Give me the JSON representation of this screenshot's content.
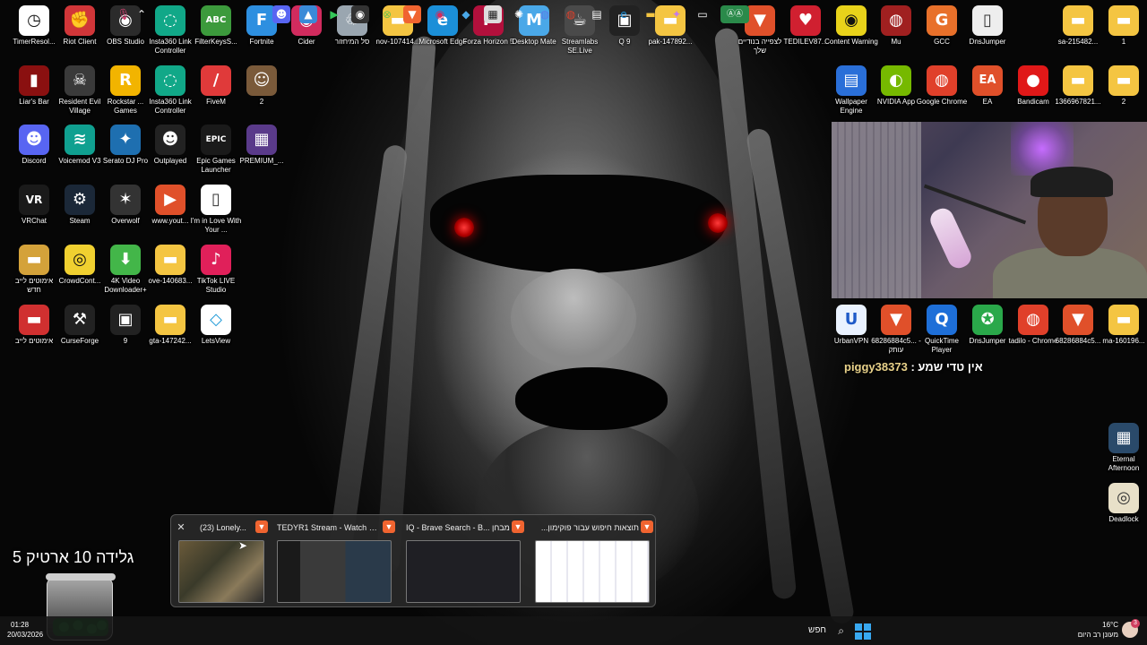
{
  "desktop_icons": [
    {
      "label": "TimerResol...",
      "glyph": "◷",
      "color": "#ffffff",
      "text_color": "#111111"
    },
    {
      "label": "Riot Client",
      "glyph": "✊",
      "color": "#d13639"
    },
    {
      "label": "OBS Studio",
      "glyph": "◉",
      "color": "#2b2b2b"
    },
    {
      "label": "Insta360 Link Controller",
      "glyph": "◌",
      "color": "#11a888"
    },
    {
      "label": "FilterKeysS...",
      "glyph": "ABC",
      "color": "#3c9a3c"
    },
    {
      "label": "Fortnite",
      "glyph": "F",
      "color": "#2d8fe0"
    },
    {
      "label": "Cider",
      "glyph": "◉",
      "color": "#d12b5e"
    },
    {
      "label": "סל המיחזור",
      "glyph": "♲",
      "color": "#9aa6b0"
    },
    {
      "label": "nov-107414...",
      "glyph": "▬",
      "color": "#f4c542"
    },
    {
      "label": "Microsoft Edge",
      "glyph": "e",
      "color": "#1b8fd8"
    },
    {
      "label": "Forza Horizon 5",
      "glyph": "F",
      "color": "#b2103c"
    },
    {
      "label": "Desktop Mate",
      "glyph": "M",
      "color": "#4aa8e8"
    },
    {
      "label": "Streamlabs SE.Live",
      "glyph": "☕",
      "color": "#4a4a4a"
    },
    {
      "label": "Q 9",
      "glyph": "▣",
      "color": "#222222"
    },
    {
      "label": "pak-147892...",
      "glyph": "▬",
      "color": "#f4c542"
    },
    {
      "label": "Liar's Bar",
      "glyph": "▮",
      "color": "#8a1010"
    },
    {
      "label": "Resident Evil Village",
      "glyph": "☠",
      "color": "#3a3a3a"
    },
    {
      "label": "Rockstar ... Games",
      "glyph": "R",
      "color": "#f2b400"
    },
    {
      "label": "Insta360 Link Controller",
      "glyph": "◌",
      "color": "#11a888"
    },
    {
      "label": "FiveM",
      "glyph": "/",
      "color": "#e03a3a"
    },
    {
      "label": "2",
      "glyph": "☺",
      "color": "#7a5a3a"
    },
    {
      "label": "Discord",
      "glyph": "☻",
      "color": "#5865f2"
    },
    {
      "label": "Voicemod V3",
      "glyph": "≋",
      "color": "#10a090"
    },
    {
      "label": "Serato DJ Pro",
      "glyph": "✦",
      "color": "#1e6fb0"
    },
    {
      "label": "Outplayed",
      "glyph": "☻",
      "color": "#222222"
    },
    {
      "label": "Epic Games Launcher",
      "glyph": "EPIC",
      "color": "#1a1a1a"
    },
    {
      "label": "PREMIUM_...",
      "glyph": "▦",
      "color": "#5a3a8a"
    },
    {
      "label": "VRChat",
      "glyph": "VR",
      "color": "#1a1a1a"
    },
    {
      "label": "Steam",
      "glyph": "⚙",
      "color": "#1b2838"
    },
    {
      "label": "Overwolf",
      "glyph": "✶",
      "color": "#333333"
    },
    {
      "label": "www.yout...",
      "glyph": "▶",
      "color": "#e0502a"
    },
    {
      "label": "I'm in Love With Your ...",
      "glyph": "▯",
      "color": "#ffffff",
      "text_color": "#333333"
    },
    {
      "label": "אימוטים לייב חדש",
      "glyph": "▬",
      "color": "#d4a23a"
    },
    {
      "label": "CrowdCont...",
      "glyph": "◎",
      "color": "#f0d030",
      "text_color": "#111111"
    },
    {
      "label": "4K Video Downloader+",
      "glyph": "⬇",
      "color": "#43b649"
    },
    {
      "label": "ove-140683...",
      "glyph": "▬",
      "color": "#f4c542"
    },
    {
      "label": "TikTok LIVE Studio",
      "glyph": "♪",
      "color": "#e0205a"
    },
    {
      "label": "אימוטים לייב",
      "glyph": "▬",
      "color": "#d03030"
    },
    {
      "label": "CurseForge",
      "glyph": "⚒",
      "color": "#222222"
    },
    {
      "label": "9",
      "glyph": "▣",
      "color": "#222222"
    },
    {
      "label": "gta-147242...",
      "glyph": "▬",
      "color": "#f4c542"
    },
    {
      "label": "LetsView",
      "glyph": "◇",
      "color": "#ffffff",
      "text_color": "#1e9ad8"
    },
    {
      "label": "לצפייה בנודיים שלך",
      "glyph": "▼",
      "color": "#e0502a"
    },
    {
      "label": "TEDILEV87...",
      "glyph": "♥",
      "color": "#d02030"
    },
    {
      "label": "Content Warning",
      "glyph": "◉",
      "color": "#e8d21a",
      "text_color": "#111111"
    },
    {
      "label": "Mu",
      "glyph": "◍",
      "color": "#a02020"
    },
    {
      "label": "GCC",
      "glyph": "G",
      "color": "#e8702a"
    },
    {
      "label": "DnsJumper",
      "glyph": "▯",
      "color": "#eeeeee",
      "text_color": "#333333"
    },
    {
      "label": "sa-215482...",
      "glyph": "▬",
      "color": "#f4c542"
    },
    {
      "label": "1",
      "glyph": "▬",
      "color": "#f4c542"
    },
    {
      "label": "Wallpaper Engine",
      "glyph": "▤",
      "color": "#2a6fd8"
    },
    {
      "label": "NVIDIA App",
      "glyph": "◐",
      "color": "#76b900"
    },
    {
      "label": "Google Chrome",
      "glyph": "◍",
      "color": "#e0402a"
    },
    {
      "label": "EA",
      "glyph": "EA",
      "color": "#e0502a"
    },
    {
      "label": "Bandicam",
      "glyph": "●",
      "color": "#e01818"
    },
    {
      "label": "1366967821...",
      "glyph": "▬",
      "color": "#f4c542"
    },
    {
      "label": "2",
      "glyph": "▬",
      "color": "#f4c542"
    },
    {
      "label": "UrbanVPN",
      "glyph": "U",
      "color": "#eaf2ff",
      "text_color": "#1e5ac8"
    },
    {
      "label": "68286884c5... - עותק",
      "glyph": "▼",
      "color": "#e0502a"
    },
    {
      "label": "QuickTime Player",
      "glyph": "Q",
      "color": "#1e6fd8"
    },
    {
      "label": "DnsJumper",
      "glyph": "✪",
      "color": "#2aa84a"
    },
    {
      "label": "tadilo - Chrome",
      "glyph": "◍",
      "color": "#e0402a"
    },
    {
      "label": "68286884c5...",
      "glyph": "▼",
      "color": "#e0502a"
    },
    {
      "label": "ma-160196...",
      "glyph": "▬",
      "color": "#f4c542"
    },
    {
      "label": "Eternal Afternoon",
      "glyph": "▦",
      "color": "#2a4a6a"
    },
    {
      "label": "Deadlock",
      "glyph": "◎",
      "color": "#e8e0c8",
      "text_color": "#333333"
    }
  ],
  "chat": {
    "username": "piggy38373",
    "separator": " : ",
    "message": "אין טדי שמע"
  },
  "overlay_text": "גלידה 10 ארטיק 5",
  "flyout": {
    "tabs": [
      {
        "title": "(23) Lonely..."
      },
      {
        "title": "TEDYR1 Stream - Watch Li..."
      },
      {
        "title": "IQ - Brave Search - B... מבחן"
      },
      {
        "title": "תוצאות חיפוש עבור פוקימון..."
      }
    ],
    "close_glyph": "✕"
  },
  "taskbar": {
    "time": "01:28",
    "date": "20/03/2026",
    "search_placeholder": "חפש",
    "temperature": "16°C",
    "weather": "מעונן רב היום",
    "notification_count": "3"
  }
}
